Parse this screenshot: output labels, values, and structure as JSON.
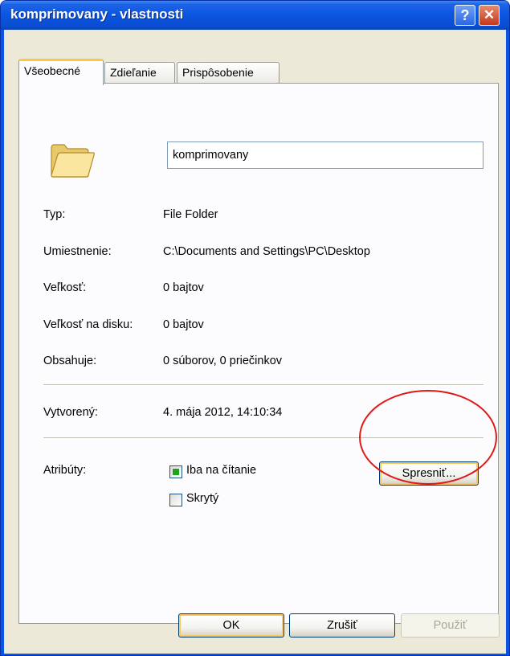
{
  "window": {
    "title": "komprimovany - vlastnosti",
    "help_label": "?",
    "close_label": "✕"
  },
  "tabs": [
    {
      "label": "Všeobecné",
      "active": true
    },
    {
      "label": "Zdieľanie",
      "active": false
    },
    {
      "label": "Prispôsobenie",
      "active": false
    }
  ],
  "general": {
    "folder_icon": "folder-icon",
    "name_value": "komprimovany",
    "rows": [
      {
        "label": "Typ:",
        "value": "File Folder"
      },
      {
        "label": "Umiestnenie:",
        "value": "C:\\Documents and Settings\\PC\\Desktop"
      },
      {
        "label": "Veľkosť:",
        "value": "0 bajtov"
      },
      {
        "label": "Veľkosť na disku:",
        "value": "0 bajtov"
      },
      {
        "label": "Obsahuje:",
        "value": "0 súborov, 0 priečinkov"
      }
    ],
    "created_label": "Vytvorený:",
    "created_value": "4. mája 2012, 14:10:34",
    "attributes_label": "Atribúty:",
    "readonly_label": "Iba na čítanie",
    "readonly_state": "indeterminate",
    "hidden_label": "Skrytý",
    "hidden_checked": false,
    "advanced_label": "Spresniť..."
  },
  "buttons": {
    "ok_label": "OK",
    "cancel_label": "Zrušiť",
    "apply_label": "Použiť"
  },
  "colors": {
    "titlebar": "#0a54e3",
    "annotation_circle": "#e01818",
    "tab_accent": "#ffc83c"
  }
}
